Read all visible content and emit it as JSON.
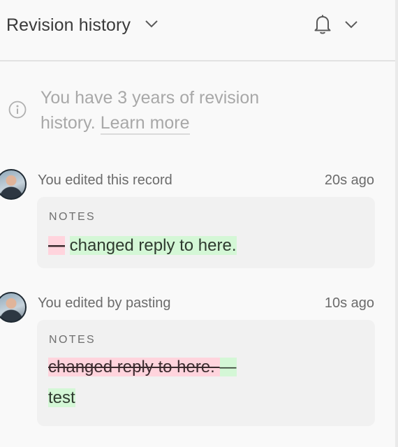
{
  "header": {
    "title": "Revision history"
  },
  "info": {
    "text": "You have 3 years of revision history.",
    "link": "Learn more"
  },
  "entries": [
    {
      "summary": "You edited this record",
      "time": "20s ago",
      "field_label": "NOTES",
      "deleted": "—",
      "inserted": "changed reply to here."
    },
    {
      "summary": "You edited by pasting",
      "time": "10s ago",
      "field_label": "NOTES",
      "deleted": "changed reply to here. ",
      "inserted_dash": "—",
      "inserted": "test"
    }
  ],
  "colors": {
    "deleted_bg": "#ffd4dd",
    "inserted_bg": "#d4f7d6",
    "card_bg": "#f1f1f1"
  }
}
